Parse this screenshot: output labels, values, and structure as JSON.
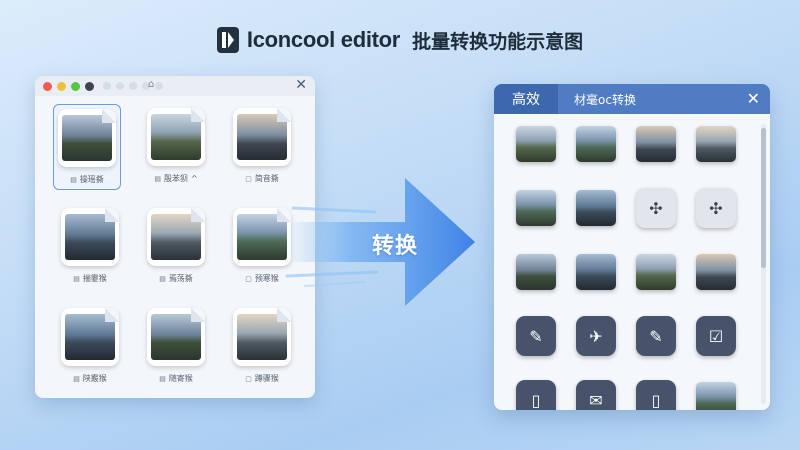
{
  "header": {
    "brand": "Iconcool editor",
    "subtitle": "批量转换功能示意图"
  },
  "left_window": {
    "title_icon": "image-icon",
    "close_glyph": "✕",
    "files": [
      {
        "label": "操瑶撕",
        "icon": "▤",
        "scene": "sc1",
        "selected": true
      },
      {
        "label": "殷苯狈",
        "icon": "▤",
        "scene": "sc2",
        "caret": "^"
      },
      {
        "label": "简音撕",
        "icon": "▢",
        "scene": "sc3"
      },
      {
        "label": "揣霎猴",
        "icon": "▤",
        "scene": "sc4"
      },
      {
        "label": "焉荡撕",
        "icon": "▤",
        "scene": "sc5"
      },
      {
        "label": "预寒猴",
        "icon": "▢",
        "scene": "sc6"
      },
      {
        "label": "陕霰猴",
        "icon": "▤",
        "scene": "sc4"
      },
      {
        "label": "随寄猴",
        "icon": "▤",
        "scene": "sc1"
      },
      {
        "label": "蹲骤猴",
        "icon": "▢",
        "scene": "sc5"
      }
    ]
  },
  "arrow": {
    "label": "转换"
  },
  "right_window": {
    "active_tab": "高效",
    "tab": "材毫oc转换",
    "close_glyph": "✕",
    "icons": [
      {
        "kind": "photo",
        "scene": "sc2"
      },
      {
        "kind": "photo",
        "scene": "sc6"
      },
      {
        "kind": "photo",
        "scene": "sc3"
      },
      {
        "kind": "photo",
        "scene": "sc5"
      },
      {
        "kind": "photo",
        "scene": "sc6"
      },
      {
        "kind": "photo",
        "scene": "sc4"
      },
      {
        "kind": "glyph",
        "glyph": "✣",
        "light": true
      },
      {
        "kind": "glyph",
        "glyph": "✣",
        "light": true
      },
      {
        "kind": "photo",
        "scene": "sc1"
      },
      {
        "kind": "photo",
        "scene": "sc4"
      },
      {
        "kind": "photo",
        "scene": "sc2"
      },
      {
        "kind": "photo",
        "scene": "sc3"
      },
      {
        "kind": "glyph",
        "glyph": "✎"
      },
      {
        "kind": "glyph",
        "glyph": "✈"
      },
      {
        "kind": "glyph",
        "glyph": "✎"
      },
      {
        "kind": "glyph",
        "glyph": "☑"
      },
      {
        "kind": "glyph",
        "glyph": "▯"
      },
      {
        "kind": "glyph",
        "glyph": "✉"
      },
      {
        "kind": "glyph",
        "glyph": "▯"
      },
      {
        "kind": "photo",
        "scene": "sc6"
      }
    ]
  }
}
